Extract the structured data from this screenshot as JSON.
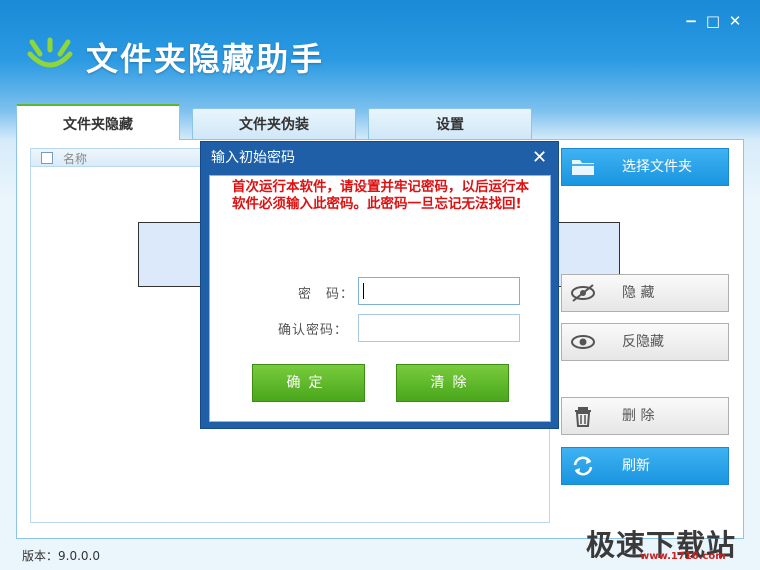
{
  "window": {
    "title": "文件夹隐藏助手",
    "controls": {
      "minimize": "−",
      "maximize": "□",
      "close": "✕"
    }
  },
  "tabs": [
    {
      "label": "文件夹隐藏",
      "active": true
    },
    {
      "label": "文件夹伪装",
      "active": false
    },
    {
      "label": "设置",
      "active": false
    }
  ],
  "file_list": {
    "column_name": "名称"
  },
  "side_buttons": {
    "select_folder": "选择文件夹",
    "hide": "隐 藏",
    "unhide": "反隐藏",
    "delete": "删 除",
    "refresh": "刷新"
  },
  "status": {
    "version": "版本：9.0.0.0"
  },
  "watermark": {
    "text": "极速下载站",
    "url": "www.1716.com"
  },
  "dialog": {
    "title": "输入初始密码",
    "close": "✕",
    "message": "首次运行本软件，请设置并牢记密码，以后运行本软件必须输入此密码。此密码一旦忘记无法找回!",
    "password_label": "密　码：",
    "confirm_label": "确认密码：",
    "password_value": "",
    "confirm_value": "",
    "ok_label": "确定",
    "clear_label": "清除"
  },
  "colors": {
    "title_blue": "#1a8ad8",
    "accent_green": "#5cb82c",
    "button_blue": "#1a95e0",
    "warning_red": "#dd1111"
  }
}
